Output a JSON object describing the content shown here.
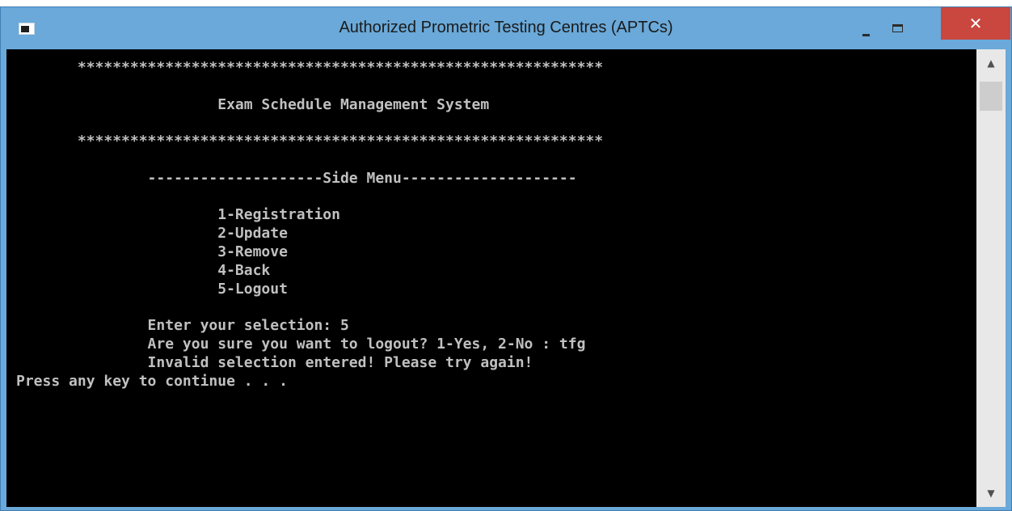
{
  "window": {
    "title": "Authorized Prometric Testing Centres (APTCs)",
    "controls": {
      "close_glyph": "✕",
      "scroll_up_glyph": "▲",
      "scroll_down_glyph": "▼"
    }
  },
  "console": {
    "lines": [
      "       ************************************************************",
      "",
      "                       Exam Schedule Management System",
      "",
      "       ************************************************************",
      "",
      "               --------------------Side Menu--------------------",
      "",
      "                       1-Registration",
      "                       2-Update",
      "                       3-Remove",
      "                       4-Back",
      "                       5-Logout",
      "",
      "               Enter your selection: 5",
      "               Are you sure you want to logout? 1-Yes, 2-No : tfg",
      "               Invalid selection entered! Please try again!",
      "Press any key to continue . . ."
    ],
    "text_color": "#c0c0c0",
    "background": "#000000"
  },
  "colors": {
    "titlebar": "#6aa9d9",
    "close_button": "#c9473f"
  },
  "icons": {
    "app": "console-app-icon",
    "minimize": "minimize-icon",
    "maximize": "maximize-icon",
    "close": "close-icon"
  }
}
